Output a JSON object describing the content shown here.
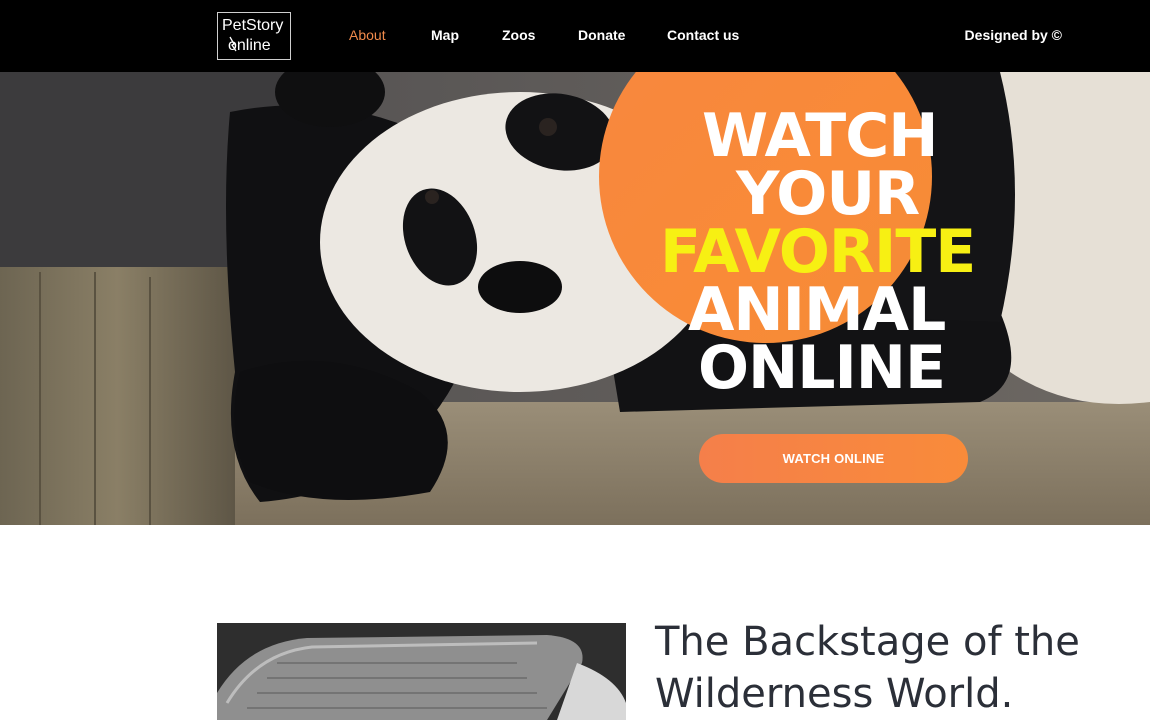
{
  "header": {
    "logo": {
      "line1": "PetStory",
      "line2": "online"
    },
    "nav": [
      {
        "label": "About",
        "active": true
      },
      {
        "label": "Map",
        "active": false
      },
      {
        "label": "Zoos",
        "active": false
      },
      {
        "label": "Donate",
        "active": false
      },
      {
        "label": "Contact us",
        "active": false
      }
    ],
    "designed_by": "Designed by ©"
  },
  "hero": {
    "headline": {
      "line1": "WATCH",
      "line2": "YOUR",
      "line3": "FAVORITE",
      "line4": "ANIMAL",
      "line5": "ONLINE"
    },
    "button_label": "WATCH ONLINE",
    "image": "panda-photo"
  },
  "section": {
    "title": "The Backstage of the Wilderness World.",
    "image": "woven-basket-photo"
  },
  "colors": {
    "accent_orange": "#f98a38",
    "nav_active": "#f08a4b",
    "headline_yellow": "#f7f013",
    "header_bg": "#000000",
    "title_text": "#2b2f38"
  }
}
